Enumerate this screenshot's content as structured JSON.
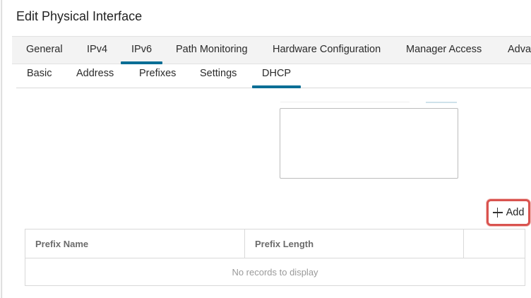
{
  "dialog": {
    "title": "Edit Physical Interface"
  },
  "tabs": [
    "General",
    "IPv4",
    "IPv6",
    "Path Monitoring",
    "Hardware Configuration",
    "Manager Access",
    "Adva"
  ],
  "active_tab": "IPv6",
  "subtabs": [
    "Basic",
    "Address",
    "Prefixes",
    "Settings",
    "DHCP"
  ],
  "active_subtab": "DHCP",
  "add_button": {
    "label": "Add",
    "icon": "plus-icon",
    "highlight_color": "#d9534f"
  },
  "table": {
    "columns": [
      "Prefix Name",
      "Prefix Length",
      ""
    ],
    "empty_message": "No records to display"
  },
  "colors": {
    "accent": "#0a6e95"
  }
}
